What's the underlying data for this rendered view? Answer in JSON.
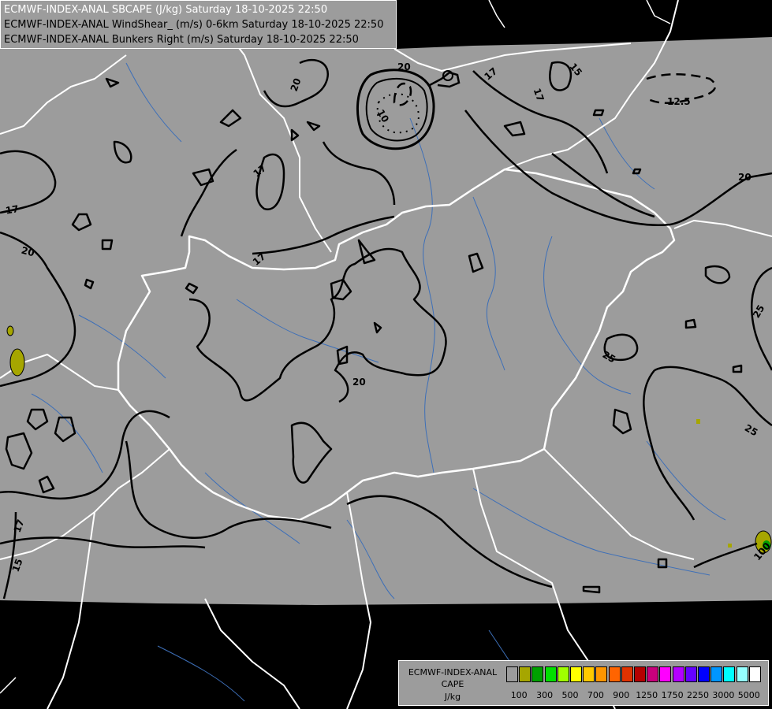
{
  "header": {
    "line1": "ECMWF-INDEX-ANAL SBCAPE (J/kg) Saturday 18-10-2025 22:50",
    "line2": "ECMWF-INDEX-ANAL WindShear_ (m/s) 0-6km Saturday 18-10-2025 22:50",
    "line3": "ECMWF-INDEX-ANAL Bunkers Right (m/s) Saturday 18-10-2025 22:50"
  },
  "legend": {
    "title1": "ECMWF-INDEX-ANAL",
    "title2": "CAPE",
    "unit": "J/kg",
    "colors": [
      "#9c9c9c",
      "#a6a600",
      "#00a000",
      "#00e000",
      "#a0ff00",
      "#ffff00",
      "#ffc800",
      "#ff9600",
      "#ff6400",
      "#e03200",
      "#b40000",
      "#c8007c",
      "#ff00ff",
      "#b400ff",
      "#6400ff",
      "#0000ff",
      "#0096ff",
      "#00ffff",
      "#96ffff",
      "#ffffff"
    ],
    "ticks": [
      "100",
      "300",
      "500",
      "700",
      "900",
      "1250",
      "1750",
      "2250",
      "3000",
      "5000"
    ]
  },
  "contour_labels": [
    {
      "id": "c20a",
      "text": "20"
    },
    {
      "id": "c20b",
      "text": "20"
    },
    {
      "id": "c20c",
      "text": "20"
    },
    {
      "id": "c20d",
      "text": "20"
    },
    {
      "id": "c20e",
      "text": "20"
    },
    {
      "id": "c17a",
      "text": "17"
    },
    {
      "id": "c17b",
      "text": "17"
    },
    {
      "id": "c17c",
      "text": "17"
    },
    {
      "id": "c17d",
      "text": "17"
    },
    {
      "id": "c17e",
      "text": "17"
    },
    {
      "id": "c17f",
      "text": "17"
    },
    {
      "id": "c15a",
      "text": "15"
    },
    {
      "id": "c15b",
      "text": "15"
    },
    {
      "id": "c125",
      "text": "12.5"
    },
    {
      "id": "c10",
      "text": "10"
    },
    {
      "id": "c25a",
      "text": "25"
    },
    {
      "id": "c25b",
      "text": "25"
    },
    {
      "id": "c25c",
      "text": "25"
    },
    {
      "id": "c100",
      "text": "100"
    }
  ],
  "colors": {
    "domain": "#9c9c9c",
    "outside": "#000000",
    "border": "#ffffff",
    "river": "#3d6fb8"
  }
}
